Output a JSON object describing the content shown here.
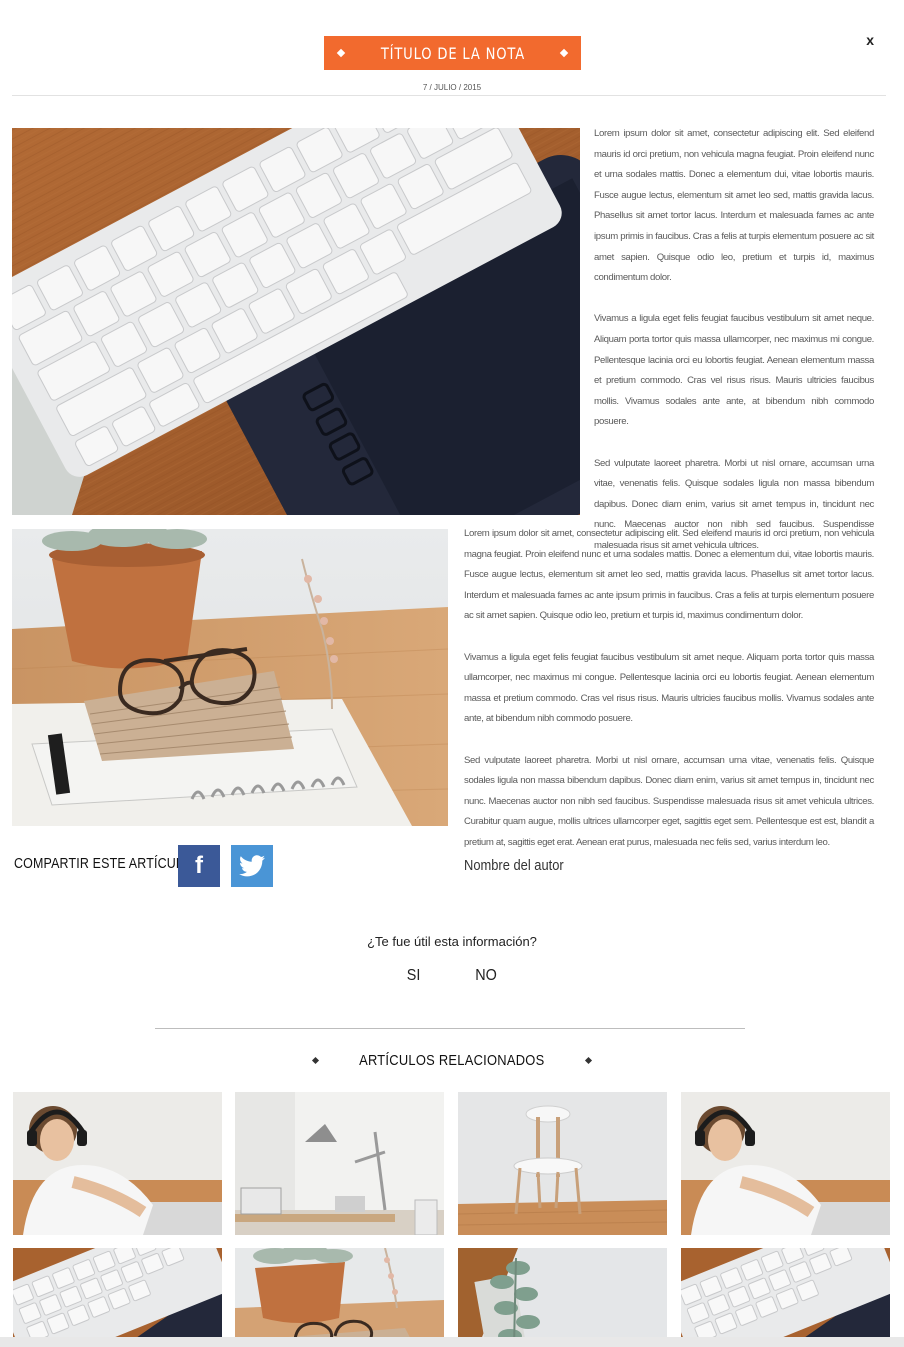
{
  "modal": {
    "close_label": "x",
    "title": "TÍTULO DE LA NOTA",
    "date": "7 / JULIO / 2015",
    "accent_color": "#f26a2e"
  },
  "article": {
    "block1": [
      "Lorem ipsum dolor sit amet, consectetur adipiscing elit. Sed eleifend mauris id orci pretium, non vehicula magna feugiat. Proin eleifend nunc et urna sodales mattis. Donec a elementum dui, vitae lobortis mauris. Fusce augue lectus, elementum sit amet leo sed, mattis gravida lacus. Phasellus sit amet tortor lacus. Interdum et malesuada fames ac ante ipsum primis in faucibus. Cras a felis at turpis elementum posuere ac sit amet sapien. Quisque odio leo, pretium et turpis id, maximus condimentum dolor.",
      "Vivamus a ligula eget felis feugiat faucibus vestibulum sit amet neque. Aliquam porta tortor quis massa ullamcorper, nec maximus mi congue. Pellentesque lacinia orci eu lobortis feugiat. Aenean elementum massa et pretium commodo. Cras vel risus risus. Mauris ultricies faucibus mollis. Vivamus sodales ante ante, at bibendum nibh commodo posuere.",
      "Sed vulputate laoreet pharetra. Morbi ut nisl ornare, accumsan urna vitae, venenatis felis. Quisque sodales ligula non massa bibendum dapibus. Donec diam enim, varius sit amet tempus in, tincidunt nec nunc. Maecenas auctor non nibh sed faucibus. Suspendisse malesuada risus sit amet vehicula ultrices."
    ],
    "block2": [
      "Lorem ipsum dolor sit amet, consectetur adipiscing elit. Sed eleifend mauris id orci pretium, non vehicula magna feugiat. Proin eleifend nunc et urna sodales mattis. Donec a elementum dui, vitae lobortis mauris. Fusce augue lectus, elementum sit amet leo sed, mattis gravida lacus. Phasellus sit amet tortor lacus. Interdum et malesuada fames ac ante ipsum primis in faucibus. Cras a felis at turpis elementum posuere ac sit amet sapien. Quisque odio leo, pretium et turpis id, maximus condimentum dolor.",
      "Vivamus a ligula eget felis feugiat faucibus vestibulum sit amet neque. Aliquam porta tortor quis massa ullamcorper, nec maximus mi congue. Pellentesque lacinia orci eu lobortis feugiat. Aenean elementum massa et pretium commodo. Cras vel risus risus. Mauris ultricies faucibus mollis. Vivamus sodales ante ante, at bibendum nibh commodo posuere.",
      "Sed vulputate laoreet pharetra. Morbi ut nisl ornare, accumsan urna vitae, venenatis felis. Quisque sodales ligula non massa bibendum dapibus. Donec diam enim, varius sit amet tempus in, tincidunt nec nunc. Maecenas auctor non nibh sed faucibus. Suspendisse malesuada risus sit amet vehicula ultrices. Curabitur quam augue, mollis ultrices ullamcorper eget, sagittis eget sem. Pellentesque est est, blandit a pretium at, sagittis eget erat. Aenean erat purus, malesuada nec felis sed, varius interdum leo."
    ]
  },
  "share": {
    "label": "COMPARTIR ESTE ARTÍCULO",
    "facebook_icon": "facebook-icon",
    "facebook_letter": "f",
    "twitter_icon": "twitter-icon",
    "facebook_color": "#3b5998",
    "twitter_color": "#4a95d6"
  },
  "author": "Nombre del autor",
  "feedback": {
    "question": "¿Te fue útil esta información?",
    "yes": "SI",
    "no": "NO"
  },
  "related": {
    "heading": "ARTÍCULOS RELACIONADOS"
  }
}
